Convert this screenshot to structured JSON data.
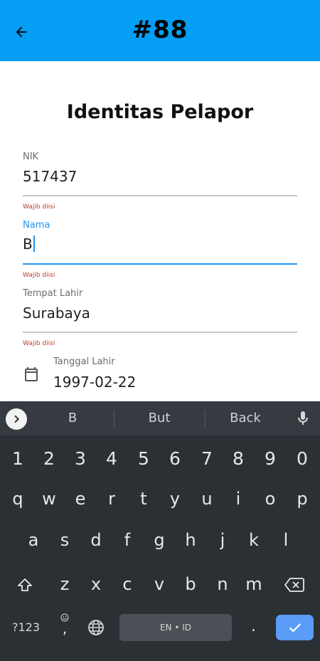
{
  "appbar": {
    "title": "#88",
    "background": "#049ef4",
    "back_icon": "arrow-left-icon"
  },
  "form": {
    "title": "Identitas Pelapor",
    "fields": [
      {
        "label": "NIK",
        "value": "517437",
        "helper": "Wajib diisi"
      },
      {
        "label": "Nama",
        "value": "B",
        "helper": "Wajib diisi",
        "focused": true
      },
      {
        "label": "Tempat Lahir",
        "value": "Surabaya",
        "helper": "Wajib diisi"
      },
      {
        "label": "Tanggal Lahir",
        "value": "1997-02-22",
        "icon": "calendar-icon"
      }
    ]
  },
  "keyboard": {
    "suggestions": [
      "B",
      "But",
      "Back"
    ],
    "number_row": [
      "1",
      "2",
      "3",
      "4",
      "5",
      "6",
      "7",
      "8",
      "9",
      "0"
    ],
    "row1": [
      "q",
      "w",
      "e",
      "r",
      "t",
      "y",
      "u",
      "i",
      "o",
      "p"
    ],
    "row2": [
      "a",
      "s",
      "d",
      "f",
      "g",
      "h",
      "j",
      "k",
      "l"
    ],
    "row3": [
      "z",
      "x",
      "c",
      "v",
      "b",
      "n",
      "m"
    ],
    "symbols_label": "?123",
    "comma": ",",
    "period": ".",
    "space_label": "EN • ID",
    "accent": "#5a9cf8"
  }
}
